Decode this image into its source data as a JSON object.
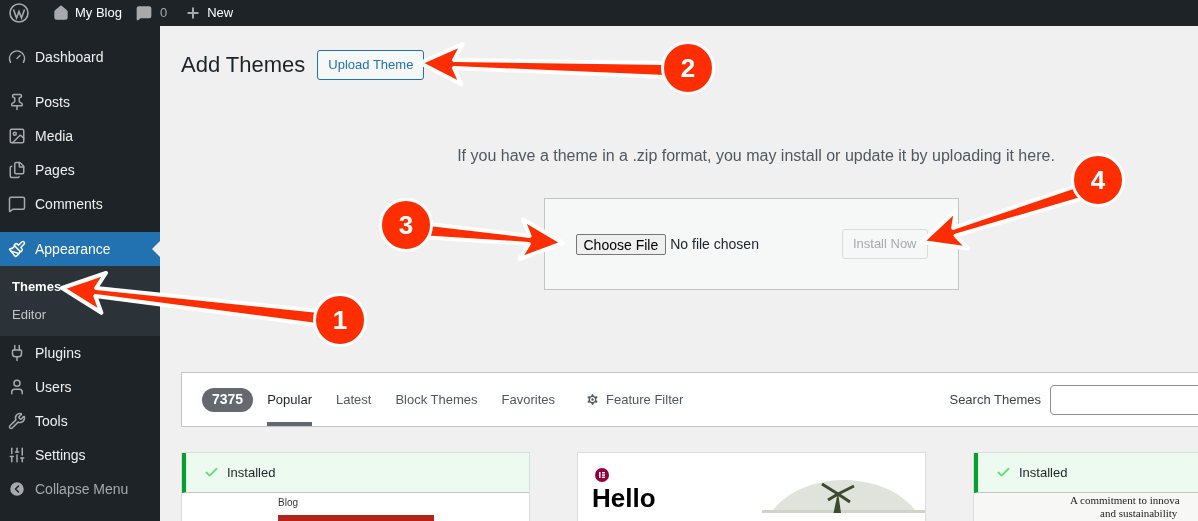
{
  "admin_bar": {
    "site": "My Blog",
    "comments": "0",
    "new": "New"
  },
  "sidebar": {
    "items": [
      {
        "label": "Dashboard",
        "selected": false
      },
      {
        "label": "Posts",
        "selected": false
      },
      {
        "label": "Media",
        "selected": false
      },
      {
        "label": "Pages",
        "selected": false
      },
      {
        "label": "Comments",
        "selected": false
      },
      {
        "label": "Appearance",
        "selected": true,
        "children": [
          {
            "label": "Themes",
            "selected": true
          },
          {
            "label": "Editor",
            "selected": false
          }
        ]
      },
      {
        "label": "Plugins",
        "selected": false
      },
      {
        "label": "Users",
        "selected": false
      },
      {
        "label": "Tools",
        "selected": false
      },
      {
        "label": "Settings",
        "selected": false
      }
    ],
    "collapse": "Collapse Menu"
  },
  "page": {
    "title": "Add Themes",
    "upload_button": "Upload Theme"
  },
  "upload": {
    "hint": "If you have a theme in a .zip format, you may install or update it by uploading it here.",
    "choose_button": "Choose File",
    "file_status": "No file chosen",
    "install_button": "Install Now",
    "install_disabled": true
  },
  "filter_bar": {
    "count": "7375",
    "tabs": [
      {
        "label": "Popular",
        "selected": true,
        "kind": "tab"
      },
      {
        "label": "Latest",
        "selected": false,
        "kind": "tab"
      },
      {
        "label": "Block Themes",
        "selected": false,
        "kind": "tab"
      },
      {
        "label": "Favorites",
        "selected": false,
        "kind": "tab"
      },
      {
        "label": "Feature Filter",
        "selected": false,
        "kind": "filter"
      }
    ],
    "search_label": "Search Themes"
  },
  "themes": [
    {
      "installed": true,
      "status": "Installed",
      "kind": "blog",
      "preview_text": [
        "Blog"
      ]
    },
    {
      "installed": false,
      "kind": "hello",
      "preview_text": [
        "Hello"
      ]
    },
    {
      "installed": true,
      "status": "Installed",
      "kind": "serif",
      "preview_text": [
        "A commitment to innova",
        "and sustainability"
      ]
    }
  ],
  "callouts": [
    "1",
    "2",
    "3",
    "4"
  ]
}
